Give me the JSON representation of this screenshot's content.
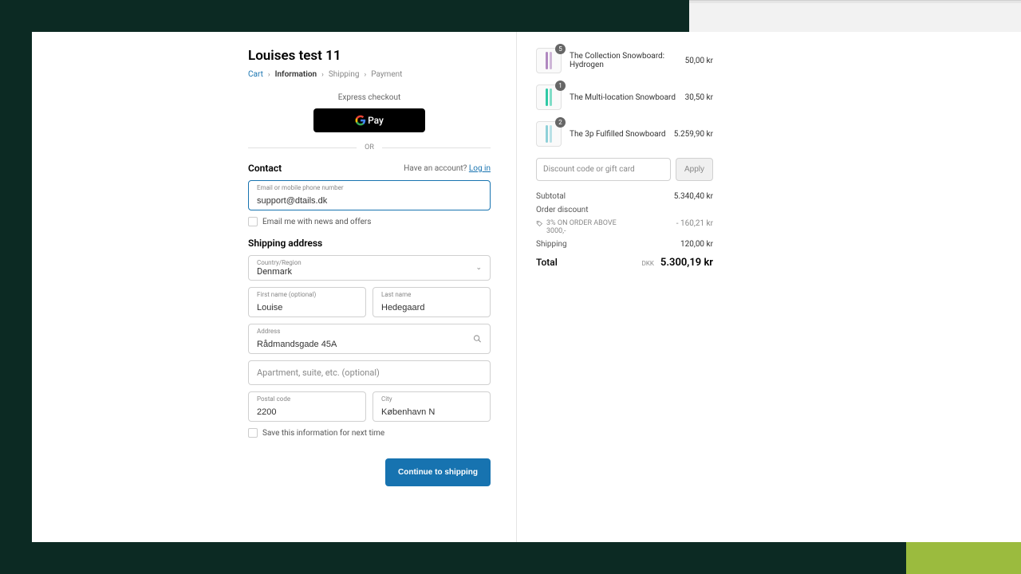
{
  "store_name": "Louises test 11",
  "breadcrumb": {
    "cart": "Cart",
    "information": "Information",
    "shipping": "Shipping",
    "payment": "Payment"
  },
  "express": {
    "label": "Express checkout",
    "gpay": "Pay",
    "or": "OR"
  },
  "contact": {
    "title": "Contact",
    "have_account": "Have an account?",
    "login": "Log in",
    "email_label": "Email or mobile phone number",
    "email_value": "support@dtails.dk",
    "news_offers": "Email me with news and offers"
  },
  "shipping": {
    "title": "Shipping address",
    "country_label": "Country/Region",
    "country_value": "Denmark",
    "first_name_label": "First name (optional)",
    "first_name_value": "Louise",
    "last_name_label": "Last name",
    "last_name_value": "Hedegaard",
    "address_label": "Address",
    "address_value": "Rådmandsgade 45A",
    "apt_placeholder": "Apartment, suite, etc. (optional)",
    "postal_label": "Postal code",
    "postal_value": "2200",
    "city_label": "City",
    "city_value": "København N",
    "save_info": "Save this information for next time"
  },
  "continue_btn": "Continue to shipping",
  "cart": {
    "items": [
      {
        "qty": "5",
        "name": "The Collection Snowboard: Hydrogen",
        "price": "50,00 kr",
        "color": "#b088c0"
      },
      {
        "qty": "1",
        "name": "The Multi-location Snowboard",
        "price": "30,50 kr",
        "color": "#2fc9a5"
      },
      {
        "qty": "2",
        "name": "The 3p Fulfilled Snowboard",
        "price": "5.259,90 kr",
        "color": "#8ed0d8"
      }
    ],
    "discount_placeholder": "Discount code or gift card",
    "apply": "Apply",
    "subtotal_label": "Subtotal",
    "subtotal_value": "5.340,40 kr",
    "order_discount_label": "Order discount",
    "discount_name": "3% ON ORDER ABOVE 3000,-",
    "discount_value": "- 160,21 kr",
    "shipping_label": "Shipping",
    "shipping_value": "120,00 kr",
    "total_label": "Total",
    "currency": "DKK",
    "total_value": "5.300,19 kr"
  }
}
